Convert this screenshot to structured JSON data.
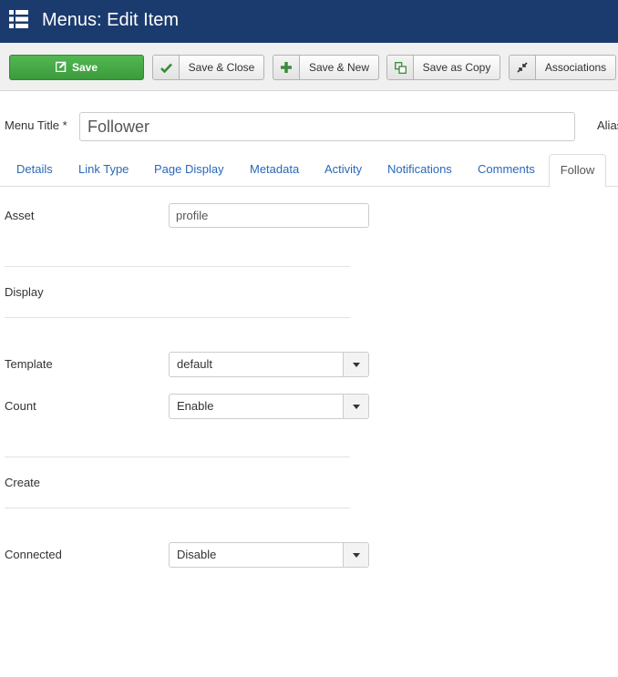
{
  "header": {
    "title": "Menus: Edit Item"
  },
  "toolbar": {
    "save_label": "Save",
    "save_close_label": "Save & Close",
    "save_new_label": "Save & New",
    "save_copy_label": "Save as Copy",
    "associations_label": "Associations"
  },
  "form": {
    "menu_title_label": "Menu Title *",
    "menu_title_value": "Follower",
    "alias_label": "Alias"
  },
  "tabs": [
    {
      "label": "Details"
    },
    {
      "label": "Link Type"
    },
    {
      "label": "Page Display"
    },
    {
      "label": "Metadata"
    },
    {
      "label": "Activity"
    },
    {
      "label": "Notifications"
    },
    {
      "label": "Comments"
    },
    {
      "label": "Follow"
    }
  ],
  "follow": {
    "asset_label": "Asset",
    "asset_value": "profile",
    "display_heading": "Display",
    "template_label": "Template",
    "template_value": "default",
    "count_label": "Count",
    "count_value": "Enable",
    "create_heading": "Create",
    "connected_label": "Connected",
    "connected_value": "Disable"
  },
  "colors": {
    "header_bg": "#1b3b6f",
    "save_green": "#46a546",
    "tab_link": "#2a69b8"
  }
}
